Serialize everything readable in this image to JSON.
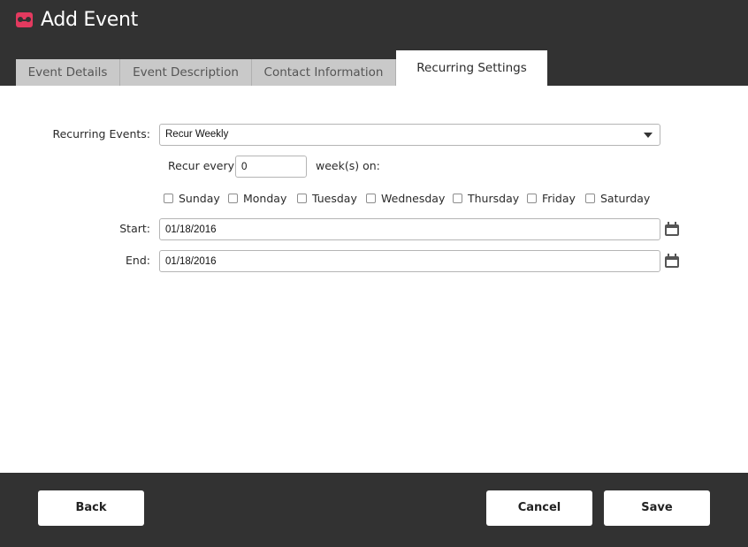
{
  "header": {
    "title": "Add Event",
    "brand_color": "#e33a5f",
    "logo_icon": "logo-icon"
  },
  "tabs": [
    {
      "label": "Event Details",
      "active": false
    },
    {
      "label": "Event Description",
      "active": false
    },
    {
      "label": "Contact Information",
      "active": false
    },
    {
      "label": "Recurring Settings",
      "active": true
    }
  ],
  "form": {
    "recurring_label": "Recurring Events:",
    "recurring_value": "Recur Weekly",
    "recur_every_label": "Recur every",
    "recur_every_value": "0",
    "weeks_on_label": "week(s) on:",
    "days": [
      {
        "label": "Sunday",
        "checked": false
      },
      {
        "label": "Monday",
        "checked": false
      },
      {
        "label": "Tuesday",
        "checked": false
      },
      {
        "label": "Wednesday",
        "checked": false
      },
      {
        "label": "Thursday",
        "checked": false
      },
      {
        "label": "Friday",
        "checked": false
      },
      {
        "label": "Saturday",
        "checked": false
      }
    ],
    "start_label": "Start:",
    "start_value": "01/18/2016",
    "end_label": "End:",
    "end_value": "01/18/2016",
    "calendar_icon": "calendar-icon"
  },
  "footer": {
    "back_label": "Back",
    "cancel_label": "Cancel",
    "save_label": "Save"
  }
}
